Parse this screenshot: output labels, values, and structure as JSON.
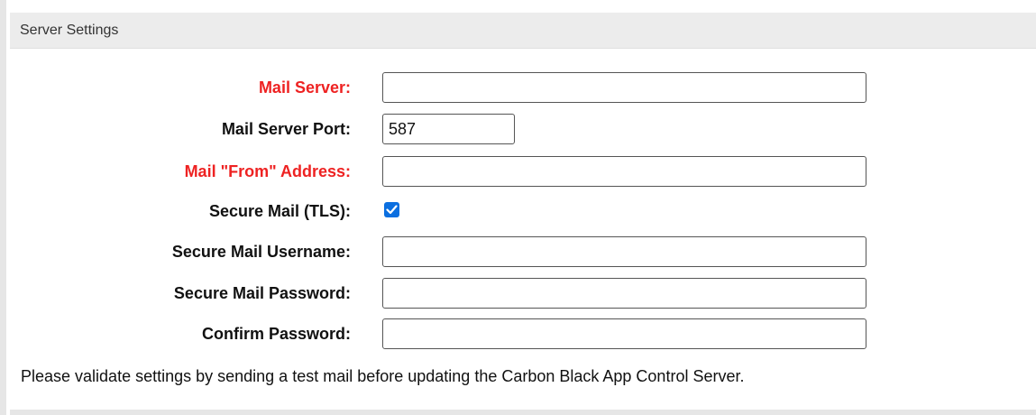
{
  "panel": {
    "title": "Server Settings"
  },
  "fields": [
    {
      "label": "Mail Server:",
      "value": "",
      "required": true
    },
    {
      "label": "Mail Server Port:",
      "value": "587",
      "required": false
    },
    {
      "label": "Mail \"From\" Address:",
      "value": "",
      "required": true
    },
    {
      "label": "Secure Mail (TLS):",
      "checked": true,
      "required": false
    },
    {
      "label": "Secure Mail Username:",
      "value": "",
      "required": false
    },
    {
      "label": "Secure Mail Password:",
      "value": "",
      "required": false
    },
    {
      "label": "Confirm Password:",
      "value": "",
      "required": false
    }
  ],
  "note": "Please validate settings by sending a test mail before updating the Carbon Black App Control Server.",
  "colors": {
    "required_label": "#ee2222",
    "checkbox_accent": "#0b6fe0"
  }
}
